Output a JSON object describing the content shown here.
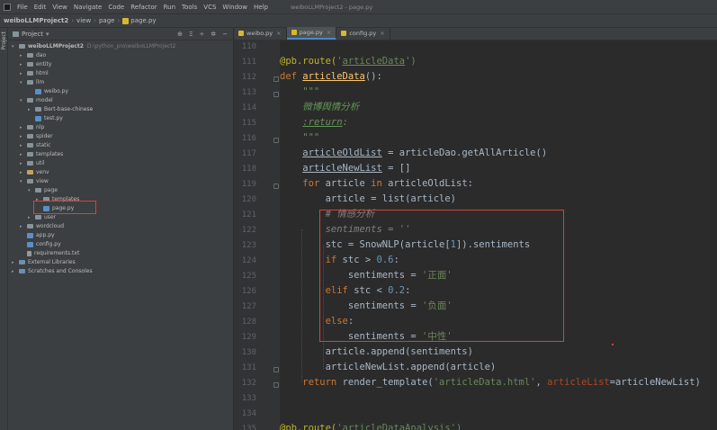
{
  "menu": {
    "items": [
      "File",
      "Edit",
      "View",
      "Navigate",
      "Code",
      "Refactor",
      "Run",
      "Tools",
      "VCS",
      "Window",
      "Help"
    ],
    "window_title": "weiboLLMProject2 - page.py"
  },
  "nav": {
    "crumbs": [
      "weiboLLMProject2",
      "view",
      "page",
      "page.py"
    ]
  },
  "project_panel": {
    "title": "Project",
    "tools": [
      "⊕",
      "Ξ",
      "÷",
      "✲",
      "−"
    ],
    "tree": [
      {
        "label": "weiboLLMProject2",
        "sub": "D:\\python_pro\\weiboLLMProject2",
        "depth": 0,
        "arrow": "v",
        "icon": "folder",
        "bold": true
      },
      {
        "label": "dao",
        "depth": 1,
        "arrow": ">",
        "icon": "folder"
      },
      {
        "label": "entity",
        "depth": 1,
        "arrow": ">",
        "icon": "folder"
      },
      {
        "label": "html",
        "depth": 1,
        "arrow": ">",
        "icon": "folder"
      },
      {
        "label": "llm",
        "depth": 1,
        "arrow": "v",
        "icon": "folder"
      },
      {
        "label": "weibo.py",
        "depth": 2,
        "arrow": "",
        "icon": "py"
      },
      {
        "label": "model",
        "depth": 1,
        "arrow": "v",
        "icon": "folder"
      },
      {
        "label": "Bert-base-chinese",
        "depth": 2,
        "arrow": ">",
        "icon": "folder"
      },
      {
        "label": "test.py",
        "depth": 2,
        "arrow": "",
        "icon": "py"
      },
      {
        "label": "nlp",
        "depth": 1,
        "arrow": ">",
        "icon": "folder"
      },
      {
        "label": "spider",
        "depth": 1,
        "arrow": ">",
        "icon": "folder"
      },
      {
        "label": "static",
        "depth": 1,
        "arrow": ">",
        "icon": "folder"
      },
      {
        "label": "templates",
        "depth": 1,
        "arrow": ">",
        "icon": "folder"
      },
      {
        "label": "util",
        "depth": 1,
        "arrow": ">",
        "icon": "folder"
      },
      {
        "label": "venv",
        "depth": 1,
        "arrow": ">",
        "icon": "folder-o"
      },
      {
        "label": "view",
        "depth": 1,
        "arrow": "v",
        "icon": "folder"
      },
      {
        "label": "page",
        "depth": 2,
        "arrow": "v",
        "icon": "folder"
      },
      {
        "label": "templates",
        "depth": 3,
        "arrow": ">",
        "icon": "folder"
      },
      {
        "label": "page.py",
        "depth": 3,
        "arrow": "",
        "icon": "py"
      },
      {
        "label": "user",
        "depth": 2,
        "arrow": ">",
        "icon": "folder"
      },
      {
        "label": "wordcloud",
        "depth": 1,
        "arrow": ">",
        "icon": "folder"
      },
      {
        "label": "app.py",
        "depth": 1,
        "arrow": "",
        "icon": "py"
      },
      {
        "label": "config.py",
        "depth": 1,
        "arrow": "",
        "icon": "py"
      },
      {
        "label": "requirements.txt",
        "depth": 1,
        "arrow": "",
        "icon": "txt"
      },
      {
        "label": "External Libraries",
        "depth": 0,
        "arrow": ">",
        "icon": "lib"
      },
      {
        "label": "Scratches and Consoles",
        "depth": 0,
        "arrow": ">",
        "icon": "lib"
      }
    ]
  },
  "editor": {
    "tabs": [
      {
        "label": "weibo.py",
        "active": false
      },
      {
        "label": "page.py",
        "active": true
      },
      {
        "label": "config.py",
        "active": false
      }
    ],
    "close_glyph": "×",
    "line_numbers": [
      "110",
      "111",
      "112",
      "113",
      "114",
      "115",
      "116",
      "117",
      "118",
      "119",
      "120",
      "121",
      "122",
      "123",
      "124",
      "125",
      "126",
      "127",
      "128",
      "129",
      "130",
      "131",
      "132",
      "133",
      "134",
      "135"
    ],
    "fold_lines": [
      "112",
      "113",
      "116",
      "119",
      "131",
      "132"
    ],
    "lines": [
      [],
      [
        {
          "t": "@pb.route(",
          "c": "dec"
        },
        {
          "t": "'",
          "c": "str"
        },
        {
          "t": "articleData",
          "c": "str ul"
        },
        {
          "t": "')",
          "c": "str"
        }
      ],
      [
        {
          "t": "def ",
          "c": "kw"
        },
        {
          "t": "articleData",
          "c": "fn ul"
        },
        {
          "t": "():",
          "c": ""
        }
      ],
      [
        {
          "t": "    \"\"\"",
          "c": "doc"
        }
      ],
      [
        {
          "t": "    微博舆情分析",
          "c": "doc"
        }
      ],
      [
        {
          "t": "    ",
          "c": ""
        },
        {
          "t": ":return",
          "c": "doc ul"
        },
        {
          "t": ":",
          "c": "doc"
        }
      ],
      [
        {
          "t": "    \"\"\"",
          "c": "doc"
        }
      ],
      [
        {
          "t": "    ",
          "c": ""
        },
        {
          "t": "articleOldList",
          "c": "ul"
        },
        {
          "t": " = articleDao.getAllArticle()",
          "c": ""
        }
      ],
      [
        {
          "t": "    ",
          "c": ""
        },
        {
          "t": "articleNewList",
          "c": "ul"
        },
        {
          "t": " = []",
          "c": ""
        }
      ],
      [
        {
          "t": "    ",
          "c": ""
        },
        {
          "t": "for ",
          "c": "kw"
        },
        {
          "t": "article ",
          "c": ""
        },
        {
          "t": "in ",
          "c": "kw"
        },
        {
          "t": "articleOldList:",
          "c": ""
        }
      ],
      [
        {
          "t": "        article = ",
          "c": ""
        },
        {
          "t": "list",
          "c": ""
        },
        {
          "t": "(article)",
          "c": ""
        }
      ],
      [
        {
          "t": "        # 情感分析",
          "c": "cm"
        }
      ],
      [
        {
          "t": "        sentiments = ",
          "c": "cm"
        },
        {
          "t": "''",
          "c": "str"
        }
      ],
      [
        {
          "t": "        stc = SnowNLP(article[",
          "c": ""
        },
        {
          "t": "1",
          "c": "num"
        },
        {
          "t": "]).sentiments",
          "c": ""
        }
      ],
      [
        {
          "t": "        ",
          "c": ""
        },
        {
          "t": "if ",
          "c": "kw"
        },
        {
          "t": "stc > ",
          "c": ""
        },
        {
          "t": "0.6",
          "c": "num"
        },
        {
          "t": ":",
          "c": ""
        }
      ],
      [
        {
          "t": "            sentiments = ",
          "c": ""
        },
        {
          "t": "'正面'",
          "c": "str"
        }
      ],
      [
        {
          "t": "        ",
          "c": ""
        },
        {
          "t": "elif ",
          "c": "kw"
        },
        {
          "t": "stc < ",
          "c": ""
        },
        {
          "t": "0.2",
          "c": "num"
        },
        {
          "t": ":",
          "c": ""
        }
      ],
      [
        {
          "t": "            sentiments = ",
          "c": ""
        },
        {
          "t": "'负面'",
          "c": "str"
        }
      ],
      [
        {
          "t": "        ",
          "c": ""
        },
        {
          "t": "else",
          "c": "kw"
        },
        {
          "t": ":",
          "c": ""
        }
      ],
      [
        {
          "t": "            sentiments = ",
          "c": ""
        },
        {
          "t": "'中性'",
          "c": "str"
        }
      ],
      [
        {
          "t": "        article.append(sentiments)",
          "c": ""
        }
      ],
      [
        {
          "t": "        articleNewList.append(article)",
          "c": ""
        }
      ],
      [
        {
          "t": "    ",
          "c": ""
        },
        {
          "t": "return ",
          "c": "kw"
        },
        {
          "t": "render_template(",
          "c": ""
        },
        {
          "t": "'articleData.html'",
          "c": "str"
        },
        {
          "t": ", ",
          "c": ""
        },
        {
          "t": "articleList",
          "c": "prm"
        },
        {
          "t": "=articleNewList)",
          "c": ""
        }
      ],
      [],
      [],
      [
        {
          "t": "@pb.route(",
          "c": "dec"
        },
        {
          "t": "'",
          "c": "str"
        },
        {
          "t": "articleDataAnalysis",
          "c": "str ul"
        },
        {
          "t": "')",
          "c": "str"
        }
      ]
    ]
  },
  "colors": {
    "highlight_box": "#e23c3c",
    "keyword": "#cc7832",
    "string": "#6a8759",
    "number": "#6897bb",
    "function": "#ffc66d",
    "decorator": "#bbb529"
  }
}
